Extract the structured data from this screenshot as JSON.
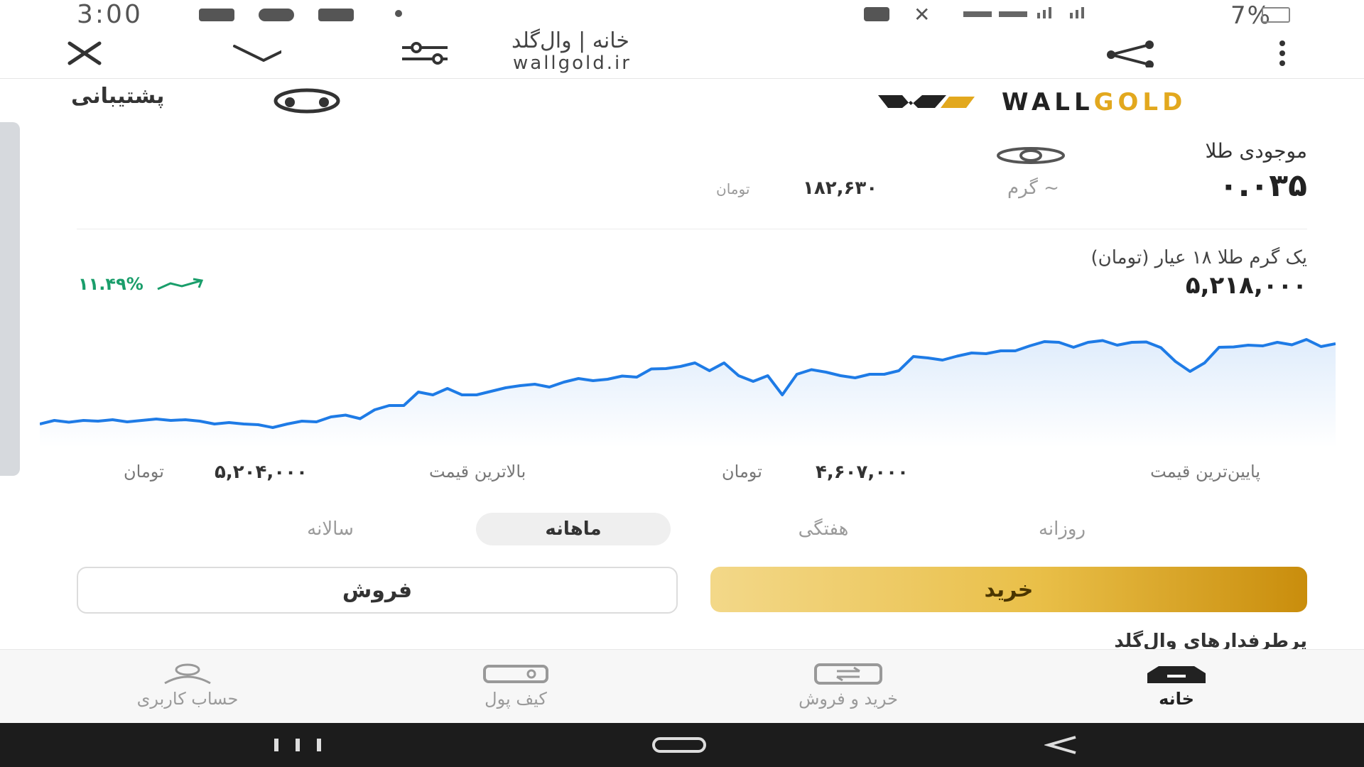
{
  "status_bar": {
    "time": "3:00",
    "battery": "7%"
  },
  "browser": {
    "title": "خانه | وال‌گلد",
    "url": "wallgold.ir"
  },
  "header": {
    "support_label": "پشتیبانی",
    "logo_wall": "WALL",
    "logo_gold": "GOLD",
    "logo_color_dark": "#222222",
    "logo_color_gold": "#e2a81e"
  },
  "balance": {
    "label": "موجودی طلا",
    "amount": "۰.۰۳۵",
    "unit": "گرم ~",
    "equivalent": "۱۸۲,۶۳۰",
    "equivalent_unit": "تومان"
  },
  "price": {
    "label": "یک گرم طلا ۱۸ عیار (تومان)",
    "value": "۵,۲۱۸,۰۰۰",
    "change": "۱۱.۴۹%",
    "change_color": "#1a9e6b"
  },
  "chart_data": {
    "type": "line",
    "y": [
      4.62,
      4.63,
      4.625,
      4.63,
      4.628,
      4.632,
      4.626,
      4.63,
      4.634,
      4.63,
      4.632,
      4.628,
      4.62,
      4.624,
      4.62,
      4.618,
      4.61,
      4.62,
      4.628,
      4.626,
      4.64,
      4.645,
      4.635,
      4.66,
      4.672,
      4.672,
      4.71,
      4.702,
      4.72,
      4.702,
      4.702,
      4.712,
      4.722,
      4.728,
      4.732,
      4.724,
      4.738,
      4.748,
      4.742,
      4.746,
      4.755,
      4.752,
      4.775,
      4.776,
      4.782,
      4.792,
      4.77,
      4.792,
      4.756,
      4.74,
      4.756,
      4.702,
      4.76,
      4.773,
      4.766,
      4.756,
      4.75,
      4.76,
      4.76,
      4.77,
      4.81,
      4.806,
      4.8,
      4.811,
      4.82,
      4.818,
      4.826,
      4.826,
      4.84,
      4.852,
      4.85,
      4.836,
      4.85,
      4.855,
      4.842,
      4.85,
      4.851,
      4.835,
      4.796,
      4.768,
      4.792,
      4.836,
      4.837,
      4.842,
      4.84,
      4.85,
      4.843,
      4.858,
      4.838,
      4.846
    ]
  },
  "range": {
    "min_label": "پایین‌ترین قیمت",
    "min_value": "۴,۶۰۷,۰۰۰",
    "min_unit": "تومان",
    "max_label": "بالاترین قیمت",
    "max_value": "۵,۲۰۴,۰۰۰",
    "max_unit": "تومان"
  },
  "tabs": [
    "روزانه",
    "هفتگی",
    "ماهانه",
    "سالانه"
  ],
  "actions": {
    "buy": "خرید",
    "sell": "فروش"
  },
  "section_title": "پرطرفدارهای وال‌گلد",
  "bottom_nav": [
    "خانه",
    "خرید و فروش",
    "کیف پول",
    "حساب کاربری"
  ],
  "accent": "#1e7be6"
}
